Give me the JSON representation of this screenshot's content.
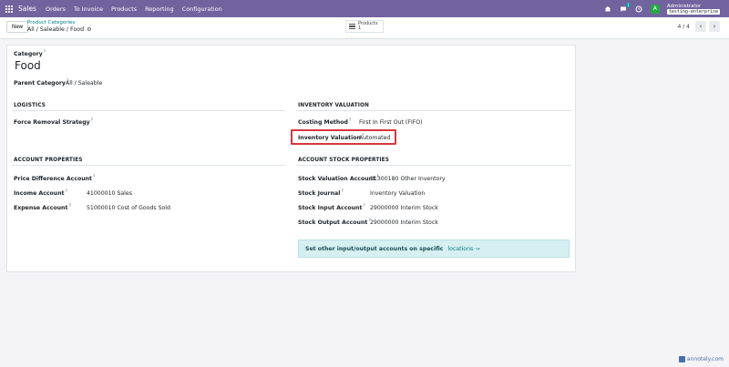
{
  "navbar": {
    "app_name": "Sales",
    "menu": [
      "Orders",
      "To Invoice",
      "Products",
      "Reporting",
      "Configuration"
    ],
    "chat_badge": "1",
    "avatar_letter": "A",
    "user_name": "Administrator",
    "database": "testing-enterprise",
    "bg_color": "#71639e"
  },
  "control": {
    "new_label": "New",
    "breadcrumb_parent": "Product Categories",
    "breadcrumb_current": "All / Saleable / Food",
    "smart_button_label": "Products",
    "smart_button_count": "1",
    "pager_value": "4 / 4"
  },
  "form": {
    "category_label": "Category",
    "category_name": "Food",
    "parent_category_label": "Parent Category",
    "parent_category_value": "All / Saleable",
    "logistics_title": "LOGISTICS",
    "force_removal_label": "Force Removal Strategy",
    "inventory_valuation_title": "INVENTORY VALUATION",
    "costing_method_label": "Costing Method",
    "costing_method_value": "First In First Out (FIFO)",
    "inventory_valuation_label": "Inventory Valuation",
    "inventory_valuation_value": "Automated",
    "account_properties_title": "ACCOUNT PROPERTIES",
    "price_diff_label": "Price Difference Account",
    "income_label": "Income Account",
    "income_value": "41000010 Sales",
    "expense_label": "Expense Account",
    "expense_value": "51000010 Cost of Goods Sold",
    "stock_properties_title": "ACCOUNT STOCK PROPERTIES",
    "stock_valuation_label": "Stock Valuation Account",
    "stock_valuation_value": "11300180 Other Inventory",
    "stock_journal_label": "Stock Journal",
    "stock_journal_value": "Inventory Valuation",
    "stock_input_label": "Stock Input Account",
    "stock_input_value": "29000000 Interim Stock",
    "stock_output_label": "Stock Output Account",
    "stock_output_value": "29000000 Interim Stock",
    "alert_text": "Set other input/output accounts on specific",
    "alert_link": "locations",
    "help_mark": "?"
  },
  "watermark": "annotely.com",
  "colors": {
    "highlight": "#d9363e",
    "link": "#017e84",
    "alert_bg": "#d6eff2"
  }
}
